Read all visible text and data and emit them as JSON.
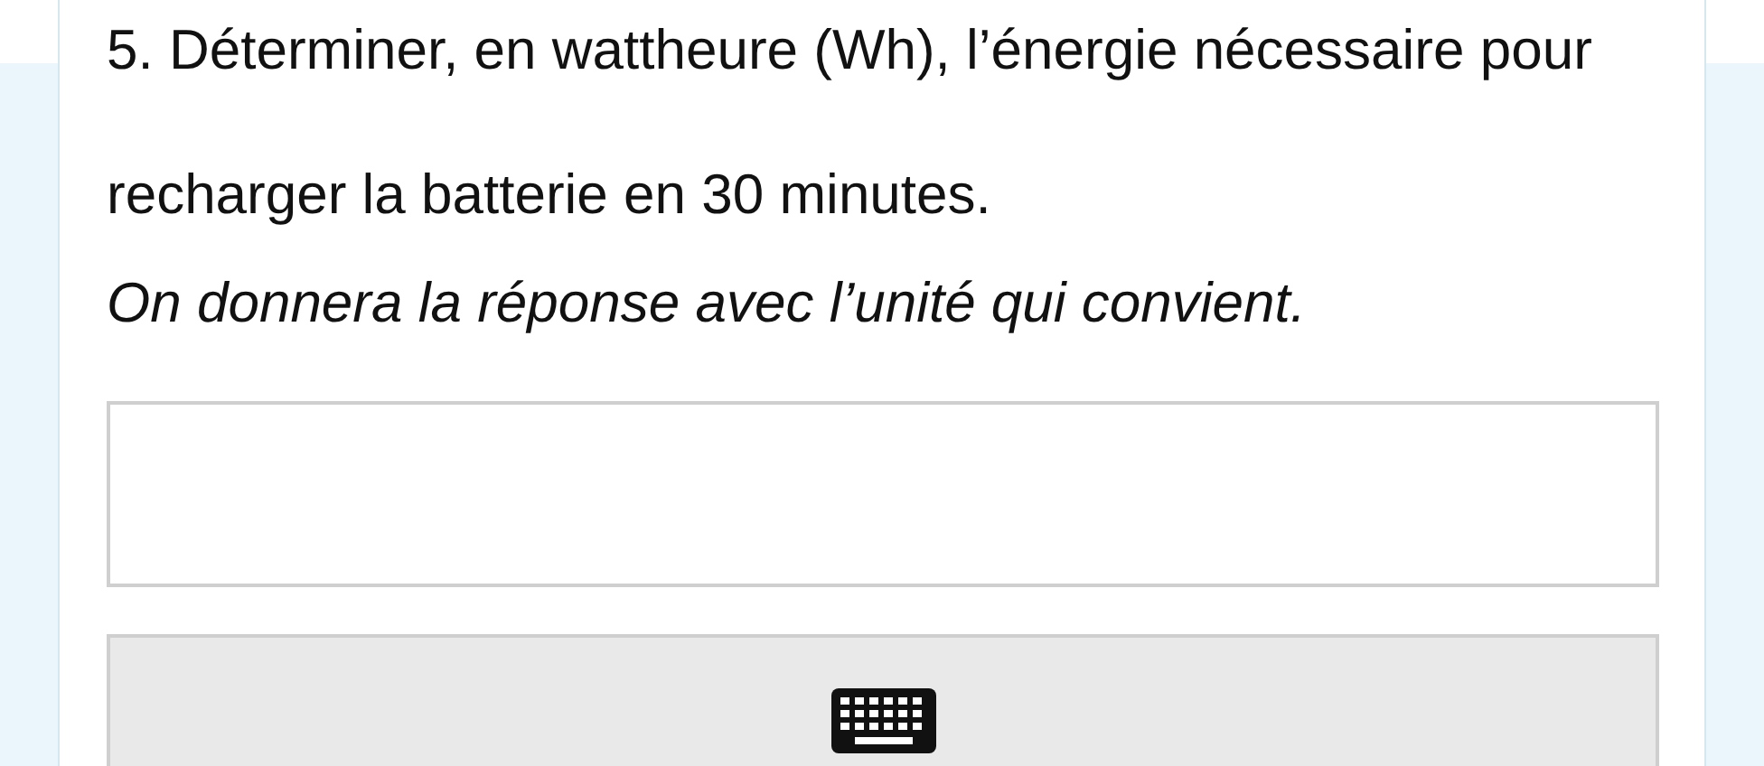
{
  "question": {
    "text": "5. Déterminer, en wattheure (Wh), l’énergie nécessaire pour recharger la batterie en 30 minutes.",
    "hint": "On donnera la réponse avec l’unité qui convient."
  },
  "keyboard_button": {
    "kind": "keyboard"
  }
}
